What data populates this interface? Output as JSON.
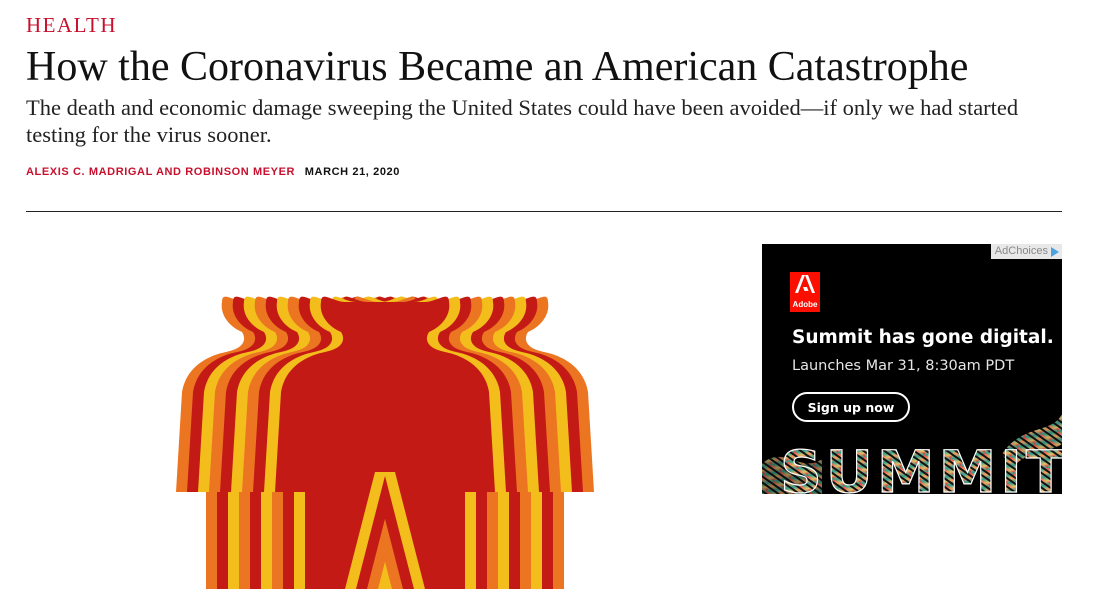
{
  "article": {
    "section": "HEALTH",
    "headline": "How the Coronavirus Became an American Catastrophe",
    "dek": "The death and economic damage sweeping the United States could have been avoided—if only we had started testing for the virus sooner.",
    "authors": "ALEXIS C. MADRIGAL AND ROBINSON MEYER",
    "date": "MARCH 21, 2020"
  },
  "hero_image": {
    "icon": "repeated-human-silhouette-illustration"
  },
  "ad": {
    "adchoices_label": "AdChoices",
    "brand": "Adobe",
    "headline": "Summit has gone digital.",
    "subtext": "Launches Mar 31, 8:30am PDT",
    "cta_label": "Sign up now",
    "art_text": "SUMMIT"
  },
  "colors": {
    "accent_red": "#c8102e",
    "hero_red": "#c41a16",
    "hero_orange": "#ec7521",
    "hero_yellow": "#f3bd1c",
    "adobe_red": "#fa0f00",
    "ad_background": "#000000"
  }
}
